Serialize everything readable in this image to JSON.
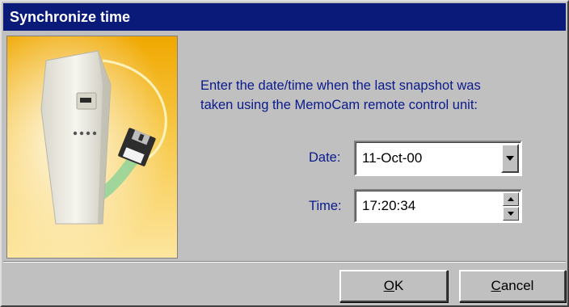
{
  "window": {
    "title": "Synchronize time"
  },
  "picture": {
    "icon": "memocam-device-illustration",
    "colors": {
      "background_top": "#f4b400",
      "background_bottom": "#ffe9a6",
      "device": "#efeee6",
      "floppy": "#2c2c2c",
      "arc": "#8fd39a"
    }
  },
  "instructions": {
    "line1": "Enter the date/time when the last snapshot was",
    "line2": "taken using the MemoCam remote control unit:"
  },
  "date_field": {
    "label": "Date:",
    "value": "11-Oct-00",
    "button_icon": "chevron-down-icon"
  },
  "time_field": {
    "label": "Time:",
    "value": "17:20:34",
    "up_icon": "spin-up-icon",
    "down_icon": "spin-down-icon"
  },
  "buttons": {
    "ok": {
      "mnemonic": "O",
      "rest": "K"
    },
    "cancel": {
      "mnemonic": "C",
      "rest": "ancel"
    }
  },
  "colors": {
    "titlebar": "#0a1a78",
    "dialog_bg": "#c0c0c0",
    "label_text": "#0a1a8c"
  }
}
